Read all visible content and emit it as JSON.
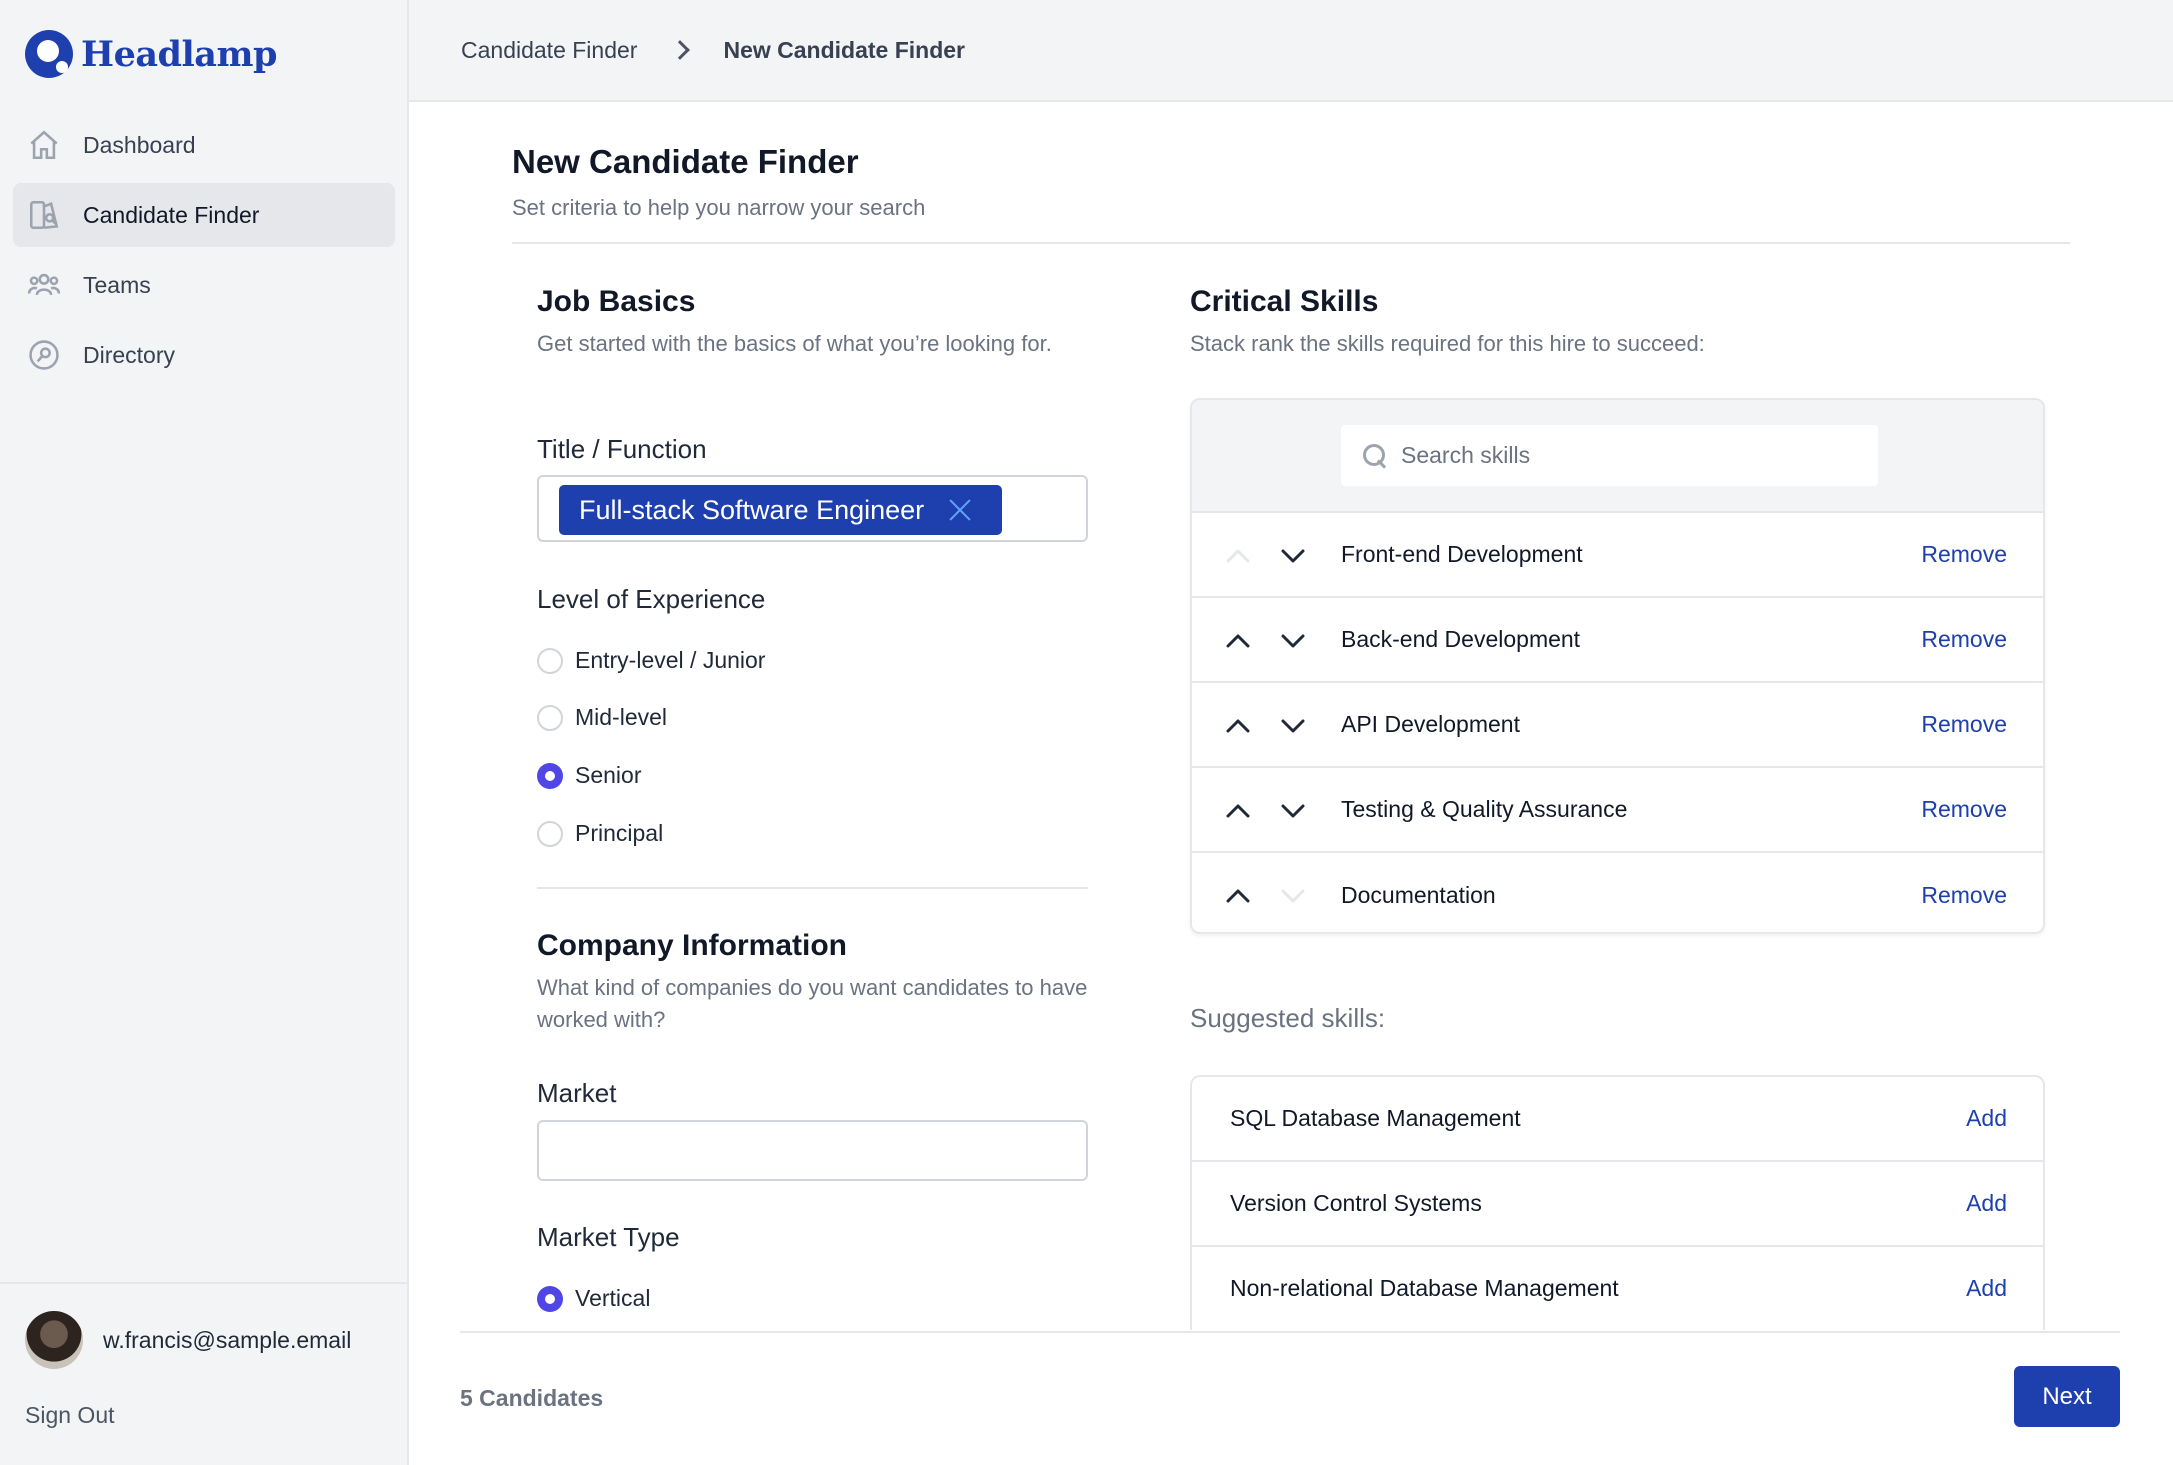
{
  "app": {
    "name": "Headlamp"
  },
  "sidebar": {
    "items": [
      {
        "label": "Dashboard",
        "icon": "home-icon"
      },
      {
        "label": "Candidate Finder",
        "icon": "candidate-finder-icon",
        "active": true
      },
      {
        "label": "Teams",
        "icon": "users-icon"
      },
      {
        "label": "Directory",
        "icon": "directory-icon"
      }
    ],
    "user": {
      "email": "w.francis@sample.email"
    },
    "signout": "Sign Out"
  },
  "breadcrumb": {
    "parent": "Candidate Finder",
    "current": "New Candidate Finder"
  },
  "page": {
    "title": "New Candidate Finder",
    "subtitle": "Set criteria to help you narrow your search"
  },
  "job_basics": {
    "title": "Job Basics",
    "description": "Get started with the basics of what you’re looking for.",
    "title_label": "Title / Function",
    "title_chip": "Full-stack Software Engineer",
    "experience_label": "Level of Experience",
    "experience_options": [
      "Entry-level / Junior",
      "Mid-level",
      "Senior",
      "Principal"
    ],
    "experience_selected": "Senior"
  },
  "company_info": {
    "title": "Company Information",
    "description": "What kind of companies do you want candidates to have worked with?",
    "market_label": "Market",
    "market_value": "",
    "market_type_label": "Market Type",
    "market_type_options": [
      "Vertical"
    ],
    "market_type_selected": "Vertical"
  },
  "critical_skills": {
    "title": "Critical Skills",
    "description": "Stack rank the skills required for this hire to succeed:",
    "search_placeholder": "Search skills",
    "remove_label": "Remove",
    "skills": [
      "Front-end Development",
      "Back-end Development",
      "API Development",
      "Testing & Quality Assurance",
      "Documentation"
    ]
  },
  "suggested_skills": {
    "label": "Suggested skills:",
    "add_label": "Add",
    "skills": [
      "SQL Database Management",
      "Version Control Systems",
      "Non-relational Database Management"
    ]
  },
  "footer": {
    "candidates": "5 Candidates",
    "next_label": "Next"
  },
  "colors": {
    "brand": "#1e40af",
    "radio_accent": "#4f46e5",
    "sidebar_bg": "#f3f4f6"
  }
}
